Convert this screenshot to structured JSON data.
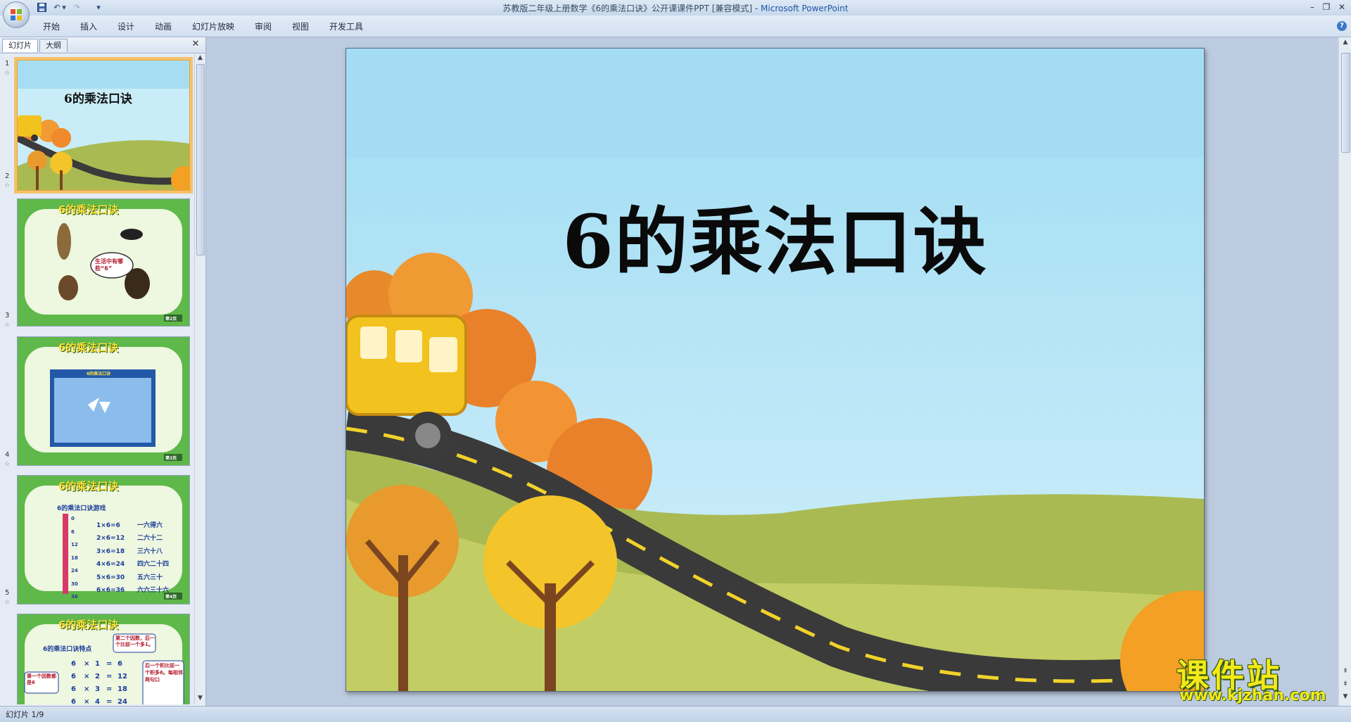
{
  "window": {
    "title": "苏教版二年级上册数学《6的乘法口诀》公开课课件PPT [兼容模式]",
    "app_name": "Microsoft PowerPoint"
  },
  "ribbon": {
    "tabs": [
      "开始",
      "插入",
      "设计",
      "动画",
      "幻灯片放映",
      "审阅",
      "视图",
      "开发工具"
    ]
  },
  "pane": {
    "tab_slides": "幻灯片",
    "tab_outline": "大纲"
  },
  "thumbnails": [
    {
      "num": "1",
      "title": "6的乘法口诀"
    },
    {
      "num": "2",
      "title": "6的乘法口诀",
      "callout": "生活中有哪些“6”",
      "footer": "第2页"
    },
    {
      "num": "3",
      "title": "6的乘法口诀",
      "inner_title": "6的乘法口诀",
      "footer": "第3页"
    },
    {
      "num": "4",
      "title": "6的乘法口诀",
      "subtitle": "6的乘法口诀游戏",
      "ruler": [
        "0",
        "6",
        "12",
        "18",
        "24",
        "30",
        "36"
      ],
      "rows": [
        [
          "1×6=6",
          "一六得六"
        ],
        [
          "2×6=12",
          "二六十二"
        ],
        [
          "3×6=18",
          "三六十八"
        ],
        [
          "4×6=24",
          "四六二十四"
        ],
        [
          "5×6=30",
          "五六三十"
        ],
        [
          "6×6=36",
          "六六三十六"
        ]
      ],
      "footer": "第4页"
    },
    {
      "num": "5",
      "title": "6的乘法口诀",
      "subtitle": "6的乘法口诀特点",
      "note_top": "第二个因数，后一个比前一个多1。",
      "note_left": "第一个因数都是6",
      "note_right": "后一个积比前一个积多6。每相邻两句口",
      "rows": [
        [
          "6",
          "×",
          "1",
          "=",
          "6"
        ],
        [
          "6",
          "×",
          "2",
          "=",
          "12"
        ],
        [
          "6",
          "×",
          "3",
          "=",
          "18"
        ],
        [
          "6",
          "×",
          "4",
          "=",
          "24"
        ]
      ]
    }
  ],
  "slide": {
    "title": "6的乘法口诀"
  },
  "status": {
    "slide_position": "幻灯片 1/9"
  },
  "watermark": {
    "text": "课件站",
    "url": "www.kjzhan.com"
  },
  "colors": {
    "sky_top": "#9fdcf3",
    "sky_bottom": "#cfeef9",
    "hill": "#a9ba52",
    "road": "#3a3a3a",
    "bus": "#f2c21e",
    "selection": "#f5c16b"
  }
}
